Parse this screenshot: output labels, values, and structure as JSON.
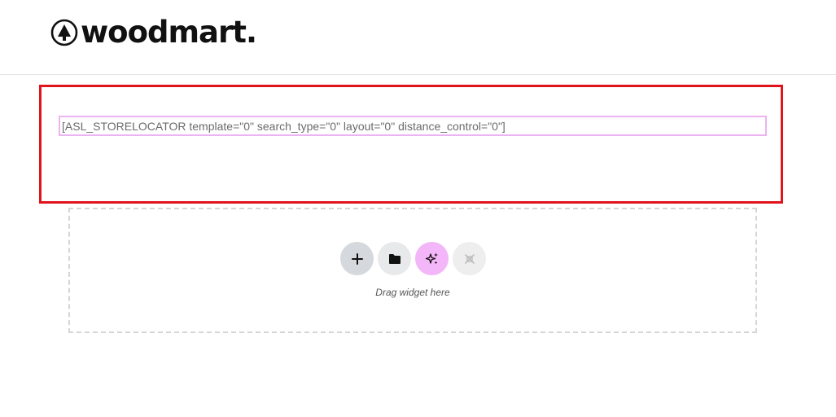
{
  "header": {
    "logo_text": "woodmart."
  },
  "content": {
    "shortcode": "[ASL_STORELOCATOR template=\"0\" search_type=\"0\" layout=\"0\" distance_control=\"0\"]"
  },
  "dropzone": {
    "actions": [
      {
        "name": "add",
        "icon": "plus-icon"
      },
      {
        "name": "template-library",
        "icon": "folder-icon"
      },
      {
        "name": "ai",
        "icon": "sparkle-icon"
      },
      {
        "name": "plugin",
        "icon": "plugin-icon"
      }
    ],
    "hint": "Drag widget here"
  },
  "colors": {
    "highlight_border": "#e0141a",
    "shortcode_border": "#ecb3f3",
    "add_button": "#d5d8dc",
    "folder_button": "#e8e9eb",
    "ai_button": "#f3b6f8",
    "plugin_button": "#eeeeee"
  }
}
